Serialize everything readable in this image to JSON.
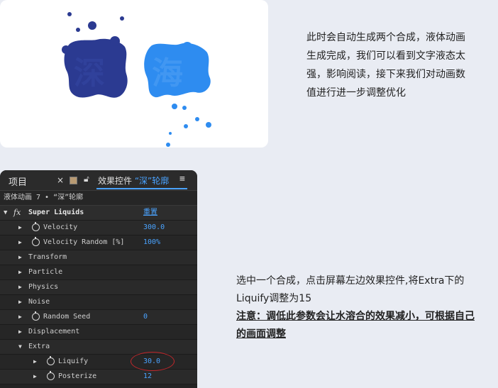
{
  "preview": {
    "glyph_left": "深",
    "glyph_right": "海",
    "color_left": "#2b3a91",
    "color_right": "#2e8cf0"
  },
  "instruction1": "此时会自动生成两个合成，液体动画生成完成，我们可以看到文字液态太强，影响阅读，接下来我们对动画数值进行进一步调整优化",
  "instruction2": {
    "line1": "选中一个合成，点击屏幕左边效果控件,将Extra下的Liquify调整为15",
    "note": "注意：调低此参数会让水溶合的效果减小，可根据自己的画面调整"
  },
  "panel": {
    "tab_project": "项目",
    "tab_effects": "效果控件",
    "tab_target": "“深”轮廓",
    "breadcrumb": "液体动画 7 • “深”轮廓",
    "effect_name": "Super Liquids",
    "reset_label": "重置",
    "rows": [
      {
        "label": "Velocity",
        "value": "300.0",
        "stopwatch": true
      },
      {
        "label": "Velocity Random [%]",
        "value": "100%",
        "stopwatch": true
      },
      {
        "label": "Transform",
        "value": "",
        "stopwatch": false
      },
      {
        "label": "Particle",
        "value": "",
        "stopwatch": false
      },
      {
        "label": "Physics",
        "value": "",
        "stopwatch": false
      },
      {
        "label": "Noise",
        "value": "",
        "stopwatch": false
      },
      {
        "label": "Random Seed",
        "value": "0",
        "stopwatch": true
      },
      {
        "label": "Displacement",
        "value": "",
        "stopwatch": false
      },
      {
        "label": "Extra",
        "value": "",
        "stopwatch": false
      },
      {
        "label": "Liquify",
        "value": "30.0",
        "stopwatch": true
      },
      {
        "label": "Posterize",
        "value": "12",
        "stopwatch": true
      }
    ]
  }
}
